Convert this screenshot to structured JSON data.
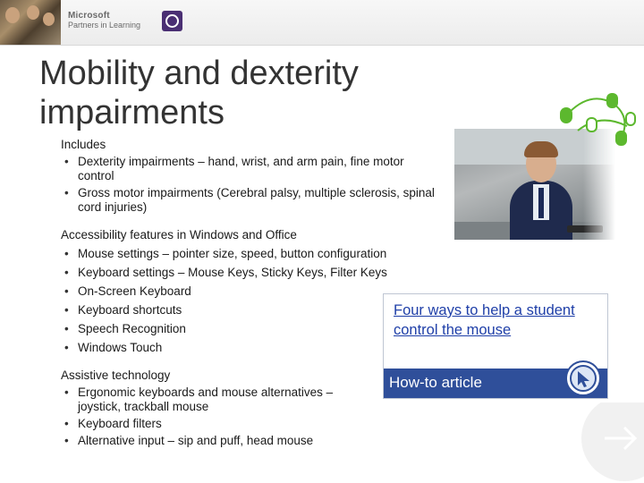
{
  "header": {
    "brand_line1": "Microsoft",
    "brand_line2": "Partners in Learning",
    "badge_icon": "partners-in-learning-icon"
  },
  "slide": {
    "title": "Mobility and dexterity impairments"
  },
  "includes": {
    "heading": "Includes",
    "items": [
      "Dexterity impairments – hand, wrist, and arm pain, fine motor control",
      "Gross motor impairments (Cerebral palsy, multiple sclerosis, spinal cord injuries)"
    ]
  },
  "features": {
    "heading": "Accessibility features in Windows and Office",
    "items": [
      "Mouse settings – pointer size, speed, button configuration",
      "Keyboard settings – Mouse Keys, Sticky Keys, Filter Keys",
      "On-Screen Keyboard",
      "Keyboard shortcuts",
      "Speech Recognition",
      "Windows Touch"
    ]
  },
  "assistive": {
    "heading": "Assistive technology",
    "items": [
      "Ergonomic  keyboards  and mouse alternatives – joystick, trackball mouse",
      "Keyboard filters",
      "Alternative input – sip and puff, head mouse"
    ]
  },
  "link_box": {
    "link_text": "Four ways to help a student control the mouse",
    "article_label": "How-to article",
    "icon": "mouse-cursor-icon"
  },
  "colors": {
    "accent_blue": "#2f4f9a",
    "link_blue": "#1f3fa8",
    "accent_green": "#5cb82e",
    "badge_purple": "#4a2f73"
  }
}
